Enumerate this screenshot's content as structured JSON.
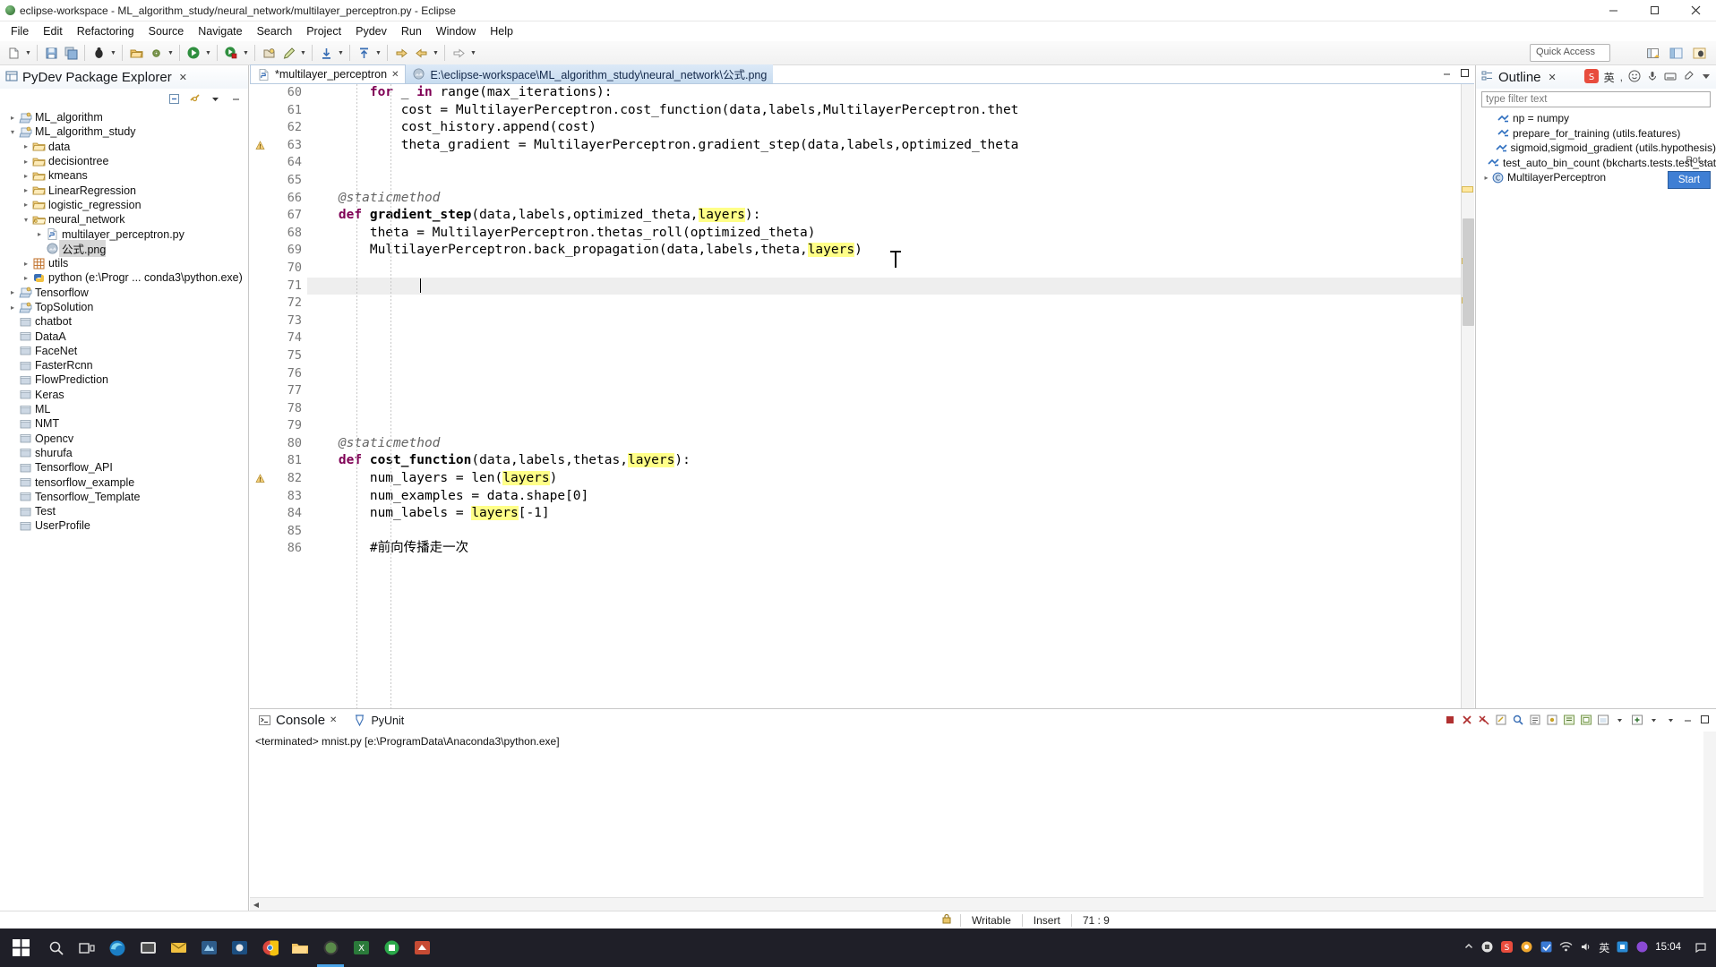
{
  "window": {
    "title": "eclipse-workspace - ML_algorithm_study/neural_network/multilayer_perceptron.py - Eclipse",
    "minimize": "–",
    "maximize": "❐",
    "close": "✕"
  },
  "menu": [
    "File",
    "Edit",
    "Refactoring",
    "Source",
    "Navigate",
    "Search",
    "Project",
    "Pydev",
    "Run",
    "Window",
    "Help"
  ],
  "toolbar": {
    "quick_access_placeholder": "Quick Access",
    "quick_access_value": "Quick Access"
  },
  "explorer": {
    "title": "PyDev Package Explorer",
    "close": "✕",
    "tree": [
      {
        "label": "ML_algorithm",
        "indent": 0,
        "arrow": "▸",
        "icon": "project-icon"
      },
      {
        "label": "ML_algorithm_study",
        "indent": 0,
        "arrow": "▾",
        "icon": "project-icon"
      },
      {
        "label": "data",
        "indent": 1,
        "arrow": "▸",
        "icon": "folder-icon"
      },
      {
        "label": "decisiontree",
        "indent": 1,
        "arrow": "▸",
        "icon": "folder-icon"
      },
      {
        "label": "kmeans",
        "indent": 1,
        "arrow": "▸",
        "icon": "folder-icon"
      },
      {
        "label": "LinearRegression",
        "indent": 1,
        "arrow": "▸",
        "icon": "folder-icon"
      },
      {
        "label": "logistic_regression",
        "indent": 1,
        "arrow": "▸",
        "icon": "folder-icon"
      },
      {
        "label": "neural_network",
        "indent": 1,
        "arrow": "▾",
        "icon": "folder-open-icon"
      },
      {
        "label": "multilayer_perceptron.py",
        "indent": 2,
        "arrow": "▸",
        "icon": "python-file-icon"
      },
      {
        "label": "公式.png",
        "indent": 2,
        "arrow": "",
        "icon": "image-file-icon",
        "selected": true
      },
      {
        "label": "utils",
        "indent": 1,
        "arrow": "▸",
        "icon": "package-icon"
      },
      {
        "label": "python  (e:\\Progr ... conda3\\python.exe)",
        "indent": 1,
        "arrow": "▸",
        "icon": "python-interpreter-icon"
      },
      {
        "label": "Tensorflow",
        "indent": 0,
        "arrow": "▸",
        "icon": "project-icon"
      },
      {
        "label": "TopSolution",
        "indent": 0,
        "arrow": "▸",
        "icon": "project-icon"
      },
      {
        "label": "chatbot",
        "indent": 0,
        "arrow": "",
        "icon": "closed-project-icon"
      },
      {
        "label": "DataA",
        "indent": 0,
        "arrow": "",
        "icon": "closed-project-icon"
      },
      {
        "label": "FaceNet",
        "indent": 0,
        "arrow": "",
        "icon": "closed-project-icon"
      },
      {
        "label": "FasterRcnn",
        "indent": 0,
        "arrow": "",
        "icon": "closed-project-icon"
      },
      {
        "label": "FlowPrediction",
        "indent": 0,
        "arrow": "",
        "icon": "closed-project-icon"
      },
      {
        "label": "Keras",
        "indent": 0,
        "arrow": "",
        "icon": "closed-project-icon"
      },
      {
        "label": "ML",
        "indent": 0,
        "arrow": "",
        "icon": "closed-project-icon"
      },
      {
        "label": "NMT",
        "indent": 0,
        "arrow": "",
        "icon": "closed-project-icon"
      },
      {
        "label": "Opencv",
        "indent": 0,
        "arrow": "",
        "icon": "closed-project-icon"
      },
      {
        "label": "shurufa",
        "indent": 0,
        "arrow": "",
        "icon": "closed-project-icon"
      },
      {
        "label": "Tensorflow_API",
        "indent": 0,
        "arrow": "",
        "icon": "closed-project-icon"
      },
      {
        "label": "tensorflow_example",
        "indent": 0,
        "arrow": "",
        "icon": "closed-project-icon"
      },
      {
        "label": "Tensorflow_Template",
        "indent": 0,
        "arrow": "",
        "icon": "closed-project-icon"
      },
      {
        "label": "Test",
        "indent": 0,
        "arrow": "",
        "icon": "closed-project-icon"
      },
      {
        "label": "UserProfile",
        "indent": 0,
        "arrow": "",
        "icon": "closed-project-icon"
      }
    ]
  },
  "editor": {
    "tabs": [
      {
        "label": "*multilayer_perceptron",
        "active": true,
        "close": "✕",
        "icon": "python-file-icon"
      },
      {
        "label": "E:\\eclipse-workspace\\ML_algorithm_study\\neural_network\\公式.png",
        "active": false,
        "close": "",
        "icon": "image-file-icon"
      }
    ],
    "first_line": 60,
    "caret_line": 71,
    "lines": [
      {
        "n": 60,
        "text": "        for _ in range(max_iterations):"
      },
      {
        "n": 61,
        "text": "            cost = MultilayerPerceptron.cost_function(data,labels,MultilayerPerceptron.thet"
      },
      {
        "n": 62,
        "text": "            cost_history.append(cost)"
      },
      {
        "n": 63,
        "text": "            theta_gradient = MultilayerPerceptron.gradient_step(data,labels,optimized_theta",
        "warning": true
      },
      {
        "n": 64,
        "text": ""
      },
      {
        "n": 65,
        "text": ""
      },
      {
        "n": 66,
        "text": "    @staticmethod"
      },
      {
        "n": 67,
        "text": "    def gradient_step(data,labels,optimized_theta,layers):",
        "fold": true
      },
      {
        "n": 68,
        "text": "        theta = MultilayerPerceptron.thetas_roll(optimized_theta)"
      },
      {
        "n": 69,
        "text": "        MultilayerPerceptron.back_propagation(data,labels,theta,layers)"
      },
      {
        "n": 70,
        "text": ""
      },
      {
        "n": 71,
        "text": ""
      },
      {
        "n": 72,
        "text": ""
      },
      {
        "n": 73,
        "text": ""
      },
      {
        "n": 74,
        "text": ""
      },
      {
        "n": 75,
        "text": ""
      },
      {
        "n": 76,
        "text": ""
      },
      {
        "n": 77,
        "text": ""
      },
      {
        "n": 78,
        "text": ""
      },
      {
        "n": 79,
        "text": ""
      },
      {
        "n": 80,
        "text": "    @staticmethod"
      },
      {
        "n": 81,
        "text": "    def cost_function(data,labels,thetas,layers):",
        "fold": true
      },
      {
        "n": 82,
        "text": "        num_layers = len(layers)",
        "warning": true
      },
      {
        "n": 83,
        "text": "        num_examples = data.shape[0]"
      },
      {
        "n": 84,
        "text": "        num_labels = layers[-1]"
      },
      {
        "n": 85,
        "text": ""
      },
      {
        "n": 86,
        "text": "        #前向传播走一次"
      }
    ]
  },
  "outline": {
    "title": "Outline",
    "close": "✕",
    "filter_placeholder": "type filter text",
    "items": [
      {
        "label": "np = numpy",
        "icon": "variable-icon",
        "indent": 1
      },
      {
        "label": "prepare_for_training (utils.features)",
        "icon": "variable-icon",
        "indent": 1
      },
      {
        "label": "sigmoid,sigmoid_gradient (utils.hypothesis)",
        "icon": "variable-icon",
        "indent": 1
      },
      {
        "label": "test_auto_bin_count (bkcharts.tests.test_stats",
        "icon": "variable-icon",
        "indent": 1
      },
      {
        "label": "MultilayerPerceptron",
        "icon": "class-icon",
        "indent": 0,
        "arrow": "▸"
      }
    ],
    "pot_label": "Pot...",
    "start_button": "Start"
  },
  "console": {
    "tabs": [
      {
        "label": "Console",
        "active": true,
        "close": "✕",
        "icon": "console-icon"
      },
      {
        "label": "PyUnit",
        "active": false,
        "close": "",
        "icon": "pyunit-icon"
      }
    ],
    "output": "<terminated> mnist.py [e:\\ProgramData\\Anaconda3\\python.exe]"
  },
  "statusbar": {
    "writable": "Writable",
    "insert_mode": "Insert",
    "position": "71 : 9",
    "lock_icon": "lock-icon"
  },
  "taskbar": {
    "clock_time": "15:04",
    "clock_date": "",
    "ime_label": "英"
  }
}
